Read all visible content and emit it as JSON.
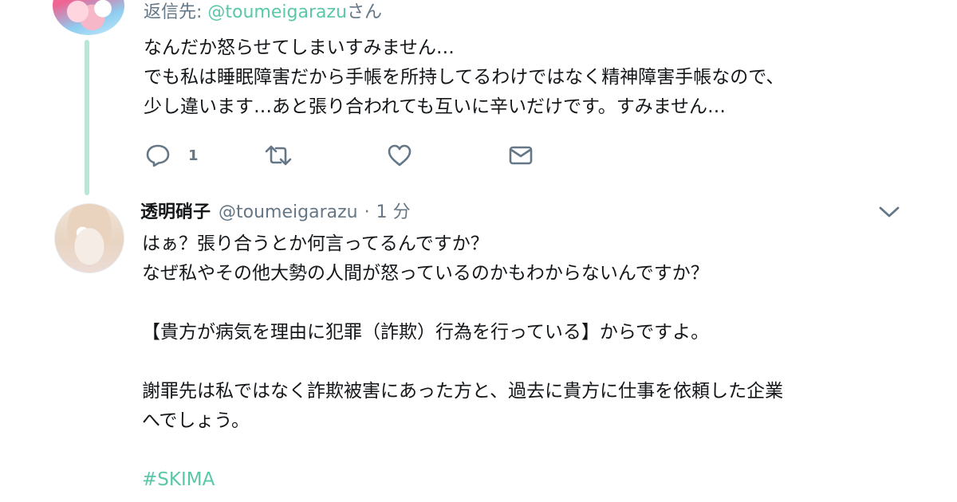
{
  "top_tweet": {
    "reply_prefix": "返信先: ",
    "reply_mention": "@toumeigarazu",
    "reply_suffix": "さん",
    "lines": [
      "なんだか怒らせてしまいすみません…",
      "でも私は睡眠障害だから手帳を所持してるわけではなく精神障害手帳なので、",
      "少し違います…あと張り合われても互いに辛いだけです。すみません…"
    ],
    "actions": {
      "reply_count": "1"
    }
  },
  "bottom_tweet": {
    "display_name": "透明硝子",
    "handle": "@toumeigarazu",
    "separator": "·",
    "time": "1 分",
    "lines": [
      "はぁ？張り合うとか何言ってるんですか？",
      "なぜ私やその他大勢の人間が怒っているのかもわからないんですか？",
      "",
      "【貴方が病気を理由に犯罪（詐欺）行為を行っている】からですよ。",
      "",
      "謝罪先は私ではなく詐欺被害にあった方と、過去に貴方に仕事を依頼した企業",
      "へでしょう。",
      ""
    ],
    "hashtag": "#SKIMA"
  },
  "icons": {
    "reply": "reply-icon",
    "retweet": "retweet-icon",
    "like": "heart-icon",
    "dm": "envelope-icon",
    "menu": "chevron-down-icon"
  },
  "colors": {
    "accent": "#5ac8a8",
    "thread_line": "#b8e6d9",
    "muted": "#657786",
    "text": "#14171a"
  }
}
